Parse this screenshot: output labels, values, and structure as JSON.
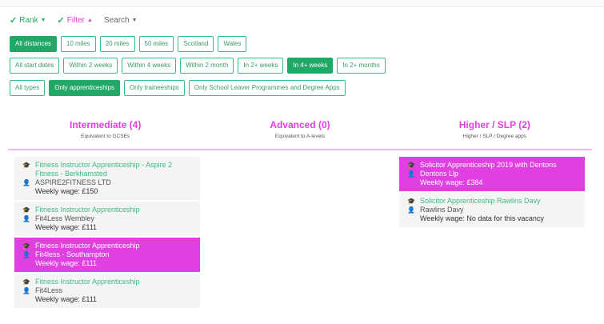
{
  "toolbar": {
    "rank": "Rank",
    "filter": "Filter",
    "search": "Search"
  },
  "distances": [
    "All distances",
    "10 miles",
    "20 miles",
    "50 miles",
    "Scotland",
    "Wales"
  ],
  "start_dates": [
    "All start dates",
    "Within 2 weeks",
    "Within 4 weeks",
    "Within 2 month",
    "In 2+ weeks",
    "In 4+ weeks",
    "In 2+ months"
  ],
  "types": [
    "All types",
    "Only apprenticeships",
    "Only traineeships",
    "Only School Leaver Programmes and Degree Apps"
  ],
  "columns": [
    {
      "title": "Intermediate (4)",
      "subtitle": "Equivalent to GCSEs"
    },
    {
      "title": "Advanced (0)",
      "subtitle": "Equivalent to A-levels"
    },
    {
      "title": "Higher / SLP (2)",
      "subtitle": "Higher / SLP / Degree apps"
    }
  ],
  "intermediate": [
    {
      "title": "Fitness Instructor Apprenticeship - Aspire 2 Fitness - Berkhamsted",
      "company": "ASPIRE2FITNESS LTD",
      "wage": "Weekly wage: £150"
    },
    {
      "title": "Fitness Instructor Apprenticeship",
      "company": "Fit4Less Wembley",
      "wage": "Weekly wage: £111"
    },
    {
      "title": "Fitness Instructor Apprenticeship",
      "company": "Fit4less - Southampton",
      "wage": "Weekly wage: £111"
    },
    {
      "title": "Fitness Instructor Apprenticeship",
      "company": "Fit4Less",
      "wage": "Weekly wage: £111"
    }
  ],
  "higher": [
    {
      "title": "Solicitor Apprenticeship 2019 with Dentons",
      "company": "Dentons Llp",
      "wage": "Weekly wage: £384"
    },
    {
      "title": "Solicitor Apprenticeship Rawlins Davy",
      "company": "Rawlins Davy",
      "wage": "Weekly wage: No data for this vacancy"
    }
  ],
  "colors": {
    "accent": "#21a867",
    "highlight": "#e040e0"
  }
}
